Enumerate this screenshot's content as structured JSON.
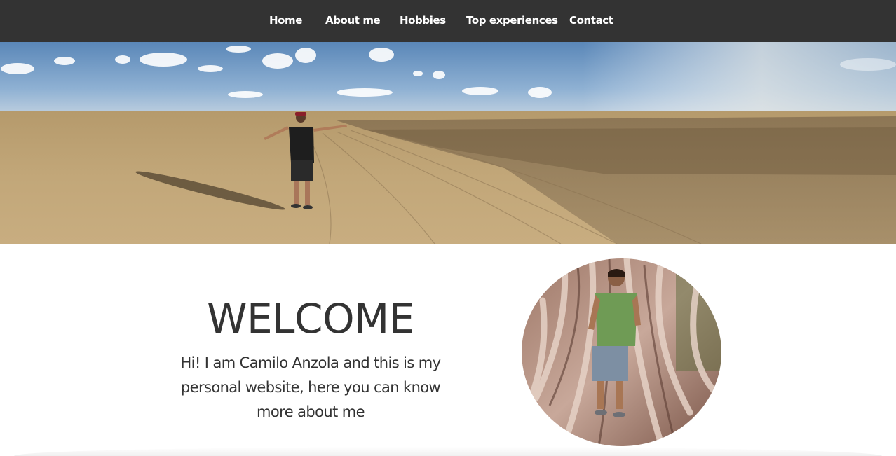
{
  "nav": {
    "items": [
      {
        "label": "Home"
      },
      {
        "label": "About me"
      },
      {
        "label": "Hobbies"
      },
      {
        "label": "Top experiences"
      },
      {
        "label": "Contact"
      }
    ]
  },
  "hero": {
    "image": "panoramic-desert-photo"
  },
  "welcome": {
    "title": "WELCOME",
    "text": "Hi! I am Camilo Anzola and this is my personal website, here you can know more about me"
  },
  "portrait": {
    "image": "profile-photo-tree-roots"
  },
  "colors": {
    "navbar": "#333333",
    "nav_text": "#ffffff",
    "body_text": "#333333",
    "background": "#ffffff"
  }
}
